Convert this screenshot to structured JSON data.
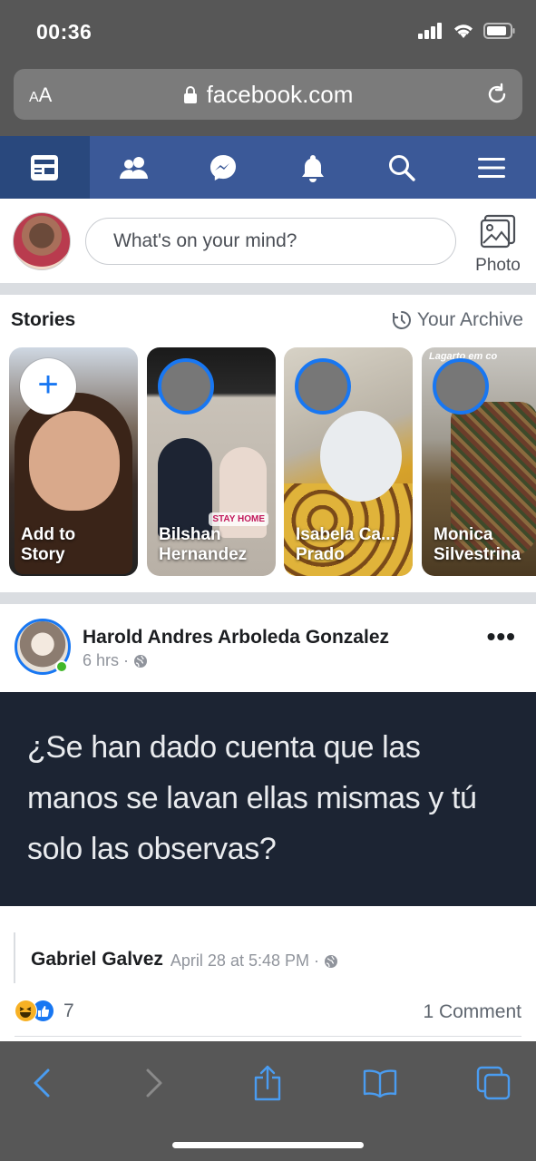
{
  "status": {
    "time": "00:36"
  },
  "browser": {
    "text_size_label_small": "A",
    "text_size_label_large": "A",
    "url": "facebook.com"
  },
  "nav": {
    "tabs": [
      "news-feed",
      "friends",
      "messenger",
      "notifications",
      "search",
      "menu"
    ],
    "active": "news-feed",
    "color": "#3b5998",
    "active_color": "#29487d"
  },
  "composer": {
    "placeholder": "What's on your mind?",
    "photo_label": "Photo"
  },
  "stories": {
    "title": "Stories",
    "archive_label": "Your Archive",
    "items": [
      {
        "label_line1": "Add to",
        "label_line2": "Story"
      },
      {
        "label_line1": "Bilshan",
        "label_line2": "Hernandez",
        "badge": "STAY HOME"
      },
      {
        "label_line1": "Isabela Ca...",
        "label_line2": "Prado"
      },
      {
        "label_line1": "Monica",
        "label_line2": "Silvestrina",
        "overlay_text": "Lagarto em co"
      }
    ]
  },
  "post": {
    "author": "Harold Andres Arboleda Gonzalez",
    "time": "6 hrs",
    "separator": "·",
    "text": "¿Se han dado cuenta que las manos se lavan ellas mismas y tú solo las observas?",
    "shared_author": "Gabriel Galvez",
    "shared_date": "April 28 at 5:48 PM",
    "reaction_count": "7",
    "comments": "1 Comment"
  },
  "accent": "#1877f2"
}
